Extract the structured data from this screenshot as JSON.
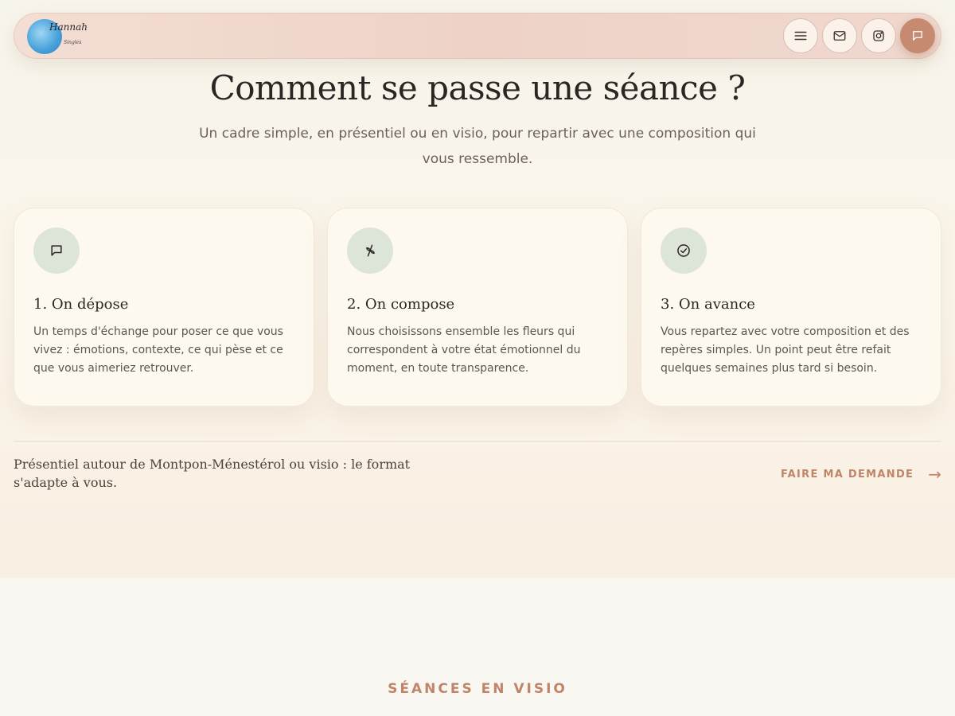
{
  "header": {
    "logo": {
      "name": "Hannah",
      "tagline": "Singles"
    },
    "buttons": [
      {
        "icon": "menu-icon",
        "label": ""
      },
      {
        "icon": "mail-icon",
        "label": ""
      },
      {
        "icon": "instagram-icon",
        "label": ""
      },
      {
        "icon": "message-icon",
        "label": ""
      }
    ]
  },
  "main": {
    "title": "Comment se passe une séance ?",
    "subtitle": "Un cadre simple, en présentiel ou en visio, pour repartir avec une composition qui vous ressemble.",
    "steps": [
      {
        "icon": "message-icon",
        "title": "1. On dépose",
        "text": "Un temps d'échange pour poser ce que vous vivez : émotions, contexte, ce qui pèse et ce que vous aimeriez retrouver."
      },
      {
        "icon": "sprout-icon",
        "title": "2. On compose",
        "text": "Nous choisissons ensemble les fleurs qui correspondent à votre état émotionnel du moment, en toute transparence."
      },
      {
        "icon": "check-circle-icon",
        "title": "3. On avance",
        "text": "Vous repartez avec votre composition et des repères simples. Un point peut être refait quelques semaines plus tard si besoin."
      }
    ],
    "format_text": "Présentiel autour de Montpon-Ménestérol ou visio : le format s'adapte à vous.",
    "cta": {
      "label": "FAIRE MA DEMANDE",
      "arrow": "→"
    }
  },
  "next_section": {
    "label": "SÉANCES EN VISIO"
  },
  "colors": {
    "accent": "#c08468",
    "icon_bg": "#dde4d8",
    "card_bg": "#fdf9ee",
    "header_bg": "#eed2c8"
  }
}
